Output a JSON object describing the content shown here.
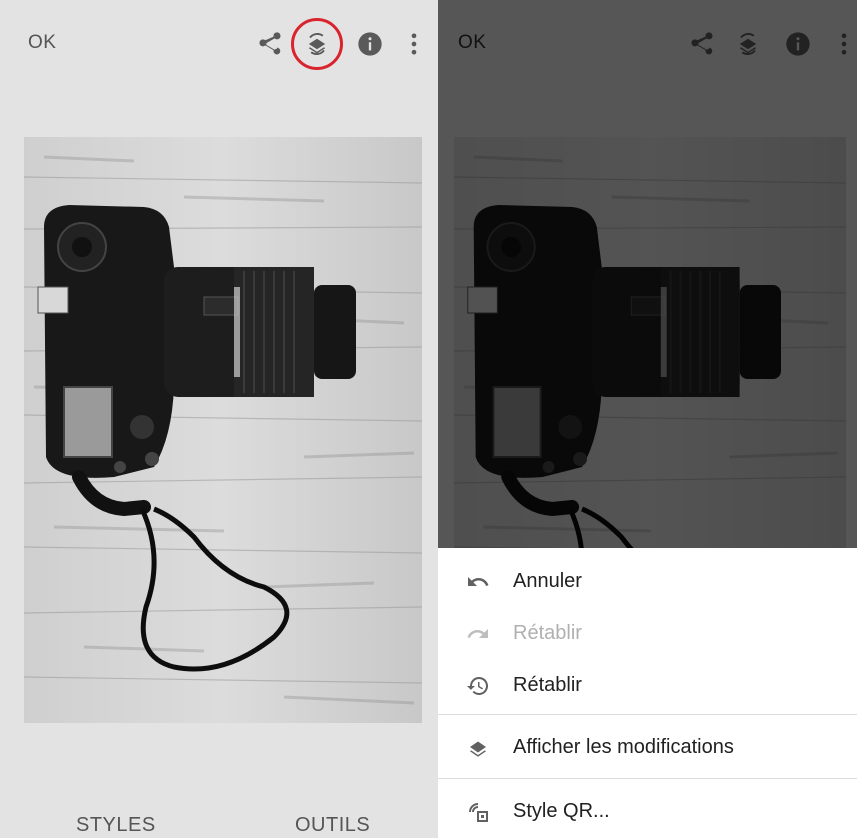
{
  "left_panel": {
    "ok_label": "OK",
    "tabs": {
      "styles": "STYLES",
      "tools": "OUTILS"
    },
    "toolbar_icons": [
      "share-icon",
      "layers-history-icon",
      "info-icon",
      "more-vert-icon"
    ],
    "highlight_color": "#d9232d"
  },
  "right_panel": {
    "ok_label": "OK",
    "toolbar_icons": [
      "share-icon",
      "layers-history-icon",
      "info-icon",
      "more-vert-icon"
    ],
    "menu": {
      "items": [
        {
          "label": "Annuler",
          "icon": "undo-icon",
          "enabled": true
        },
        {
          "label": "Rétablir",
          "icon": "redo-icon",
          "enabled": false
        },
        {
          "label": "Rétablir",
          "icon": "restore-icon",
          "enabled": true
        },
        {
          "label": "Afficher les modifications",
          "icon": "layers-icon",
          "enabled": true
        },
        {
          "label": "Style QR...",
          "icon": "qr-style-icon",
          "enabled": true
        }
      ]
    }
  },
  "colors": {
    "background": "#e3e3e3",
    "sheet": "#ffffff",
    "text": "#212121",
    "muted": "#b0b0b0"
  }
}
